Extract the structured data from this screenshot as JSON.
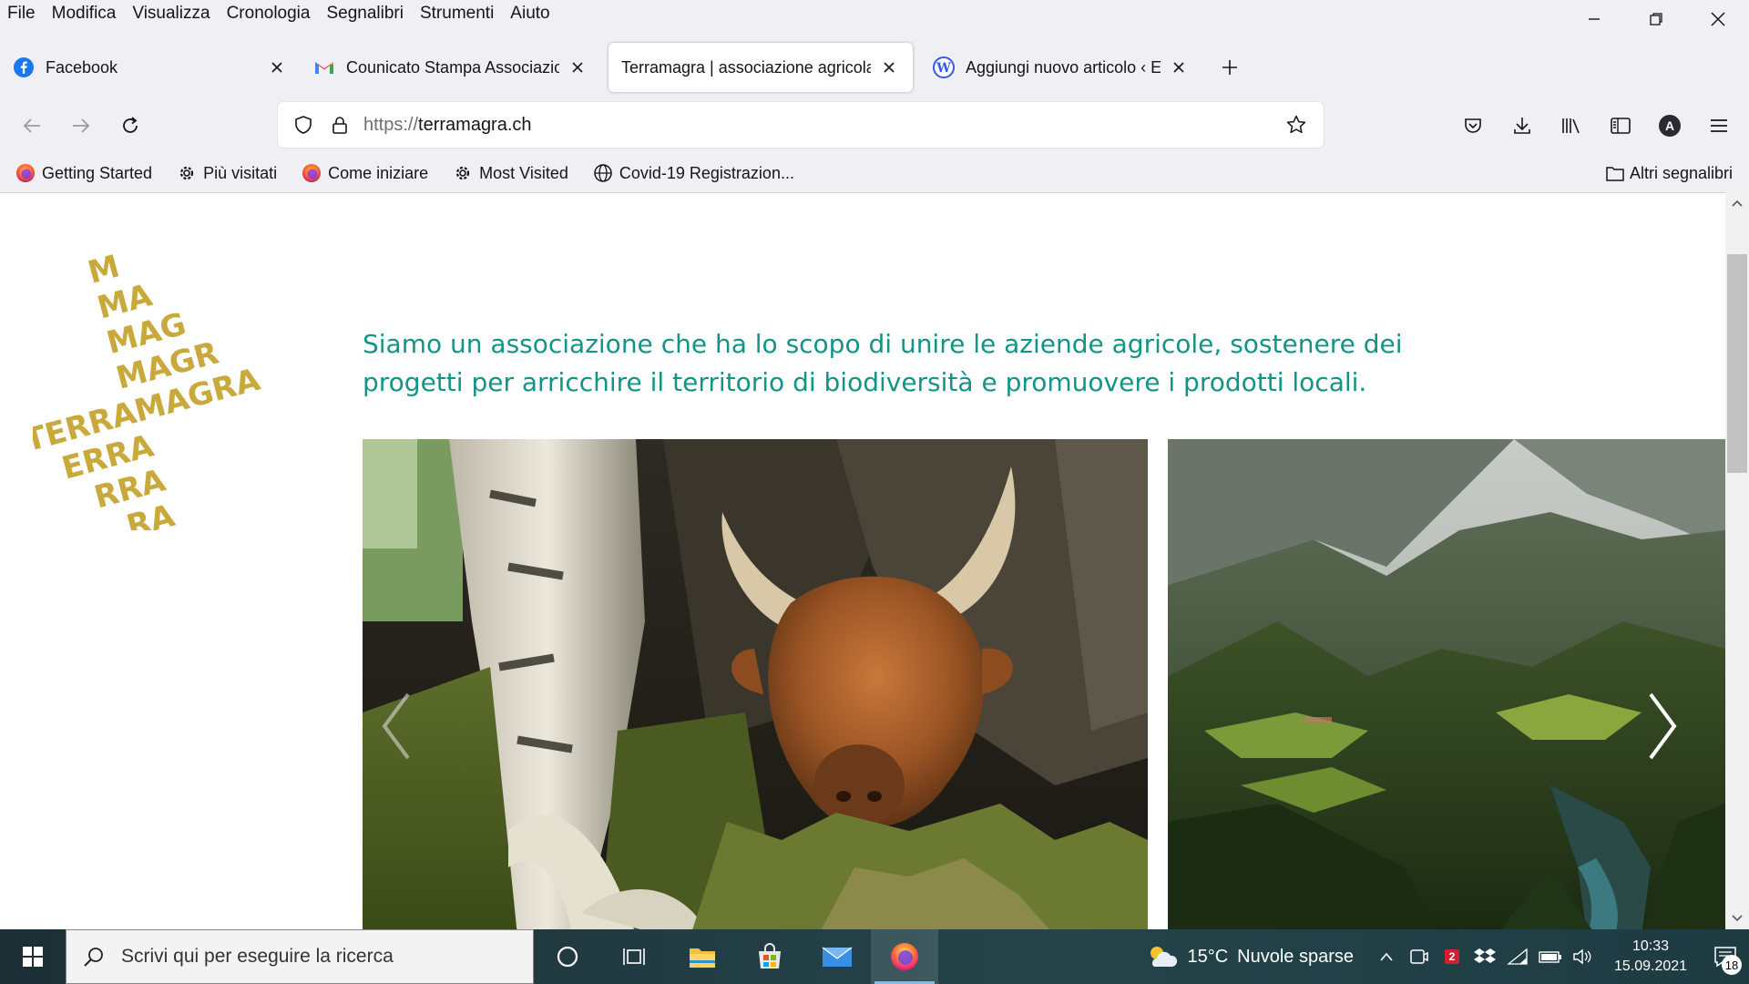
{
  "menubar": {
    "items": [
      "File",
      "Modifica",
      "Visualizza",
      "Cronologia",
      "Segnalibri",
      "Strumenti",
      "Aiuto"
    ]
  },
  "tabs": [
    {
      "title": "Facebook",
      "icon": "facebook-icon",
      "active": false
    },
    {
      "title": "Counicato Stampa Associazione",
      "icon": "gmail-icon",
      "active": false
    },
    {
      "title": "Terramagra | associazione agricola",
      "icon": "none",
      "active": true
    },
    {
      "title": "Aggiungi nuovo articolo ‹ ETiCir",
      "icon": "wordpress-icon",
      "active": false
    }
  ],
  "urlbar": {
    "scheme": "https://",
    "host": "terramagra.ch"
  },
  "bookmarks": {
    "items": [
      {
        "label": "Getting Started",
        "icon": "firefox-icon"
      },
      {
        "label": "Più visitati",
        "icon": "gear-icon"
      },
      {
        "label": "Come iniziare",
        "icon": "firefox-icon"
      },
      {
        "label": "Most Visited",
        "icon": "gear-icon"
      },
      {
        "label": "Covid-19 Registrazion...",
        "icon": "globe-icon"
      }
    ],
    "other": "Altri segnalibri"
  },
  "page": {
    "logo_words": [
      "TERRAMAGRA"
    ],
    "intro": "Siamo un associazione che ha lo scopo di unire le aziende agricole, sostenere dei progetti per arricchire il territorio di biodiversità e promuovere i prodotti locali.",
    "brand_color": "#139487",
    "logo_color": "#c9a93c"
  },
  "taskbar": {
    "search_placeholder": "Scrivi qui per eseguire la ricerca",
    "weather_temp": "15°C",
    "weather_text": "Nuvole sparse",
    "time": "10:33",
    "date": "15.09.2021",
    "notification_count": "18",
    "update_badge": "2"
  }
}
